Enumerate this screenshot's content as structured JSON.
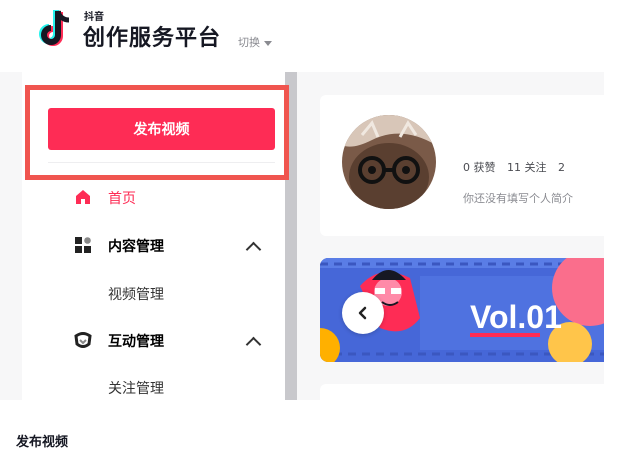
{
  "header": {
    "logo_small": "抖音",
    "logo_title": "创作服务平台",
    "switch_label": "切换"
  },
  "sidebar": {
    "publish_button": "发布视频",
    "items": [
      {
        "label": "首页",
        "icon": "home-icon",
        "active": true
      },
      {
        "label": "内容管理",
        "icon": "content-grid-icon",
        "expandable": true
      },
      {
        "label": "视频管理",
        "sub": true
      },
      {
        "label": "互动管理",
        "icon": "interaction-icon",
        "expandable": true
      },
      {
        "label": "关注管理",
        "sub": true
      }
    ]
  },
  "profile": {
    "likes": "0 获赞",
    "following": "11 关注",
    "followers": "2",
    "bio": "你还没有填写个人简介"
  },
  "banner": {
    "text": "Vol.01"
  },
  "caption": "发布视频",
  "colors": {
    "brand": "#fe2c55",
    "highlight": "#f0554f",
    "banner_blue": "#4667d8"
  }
}
